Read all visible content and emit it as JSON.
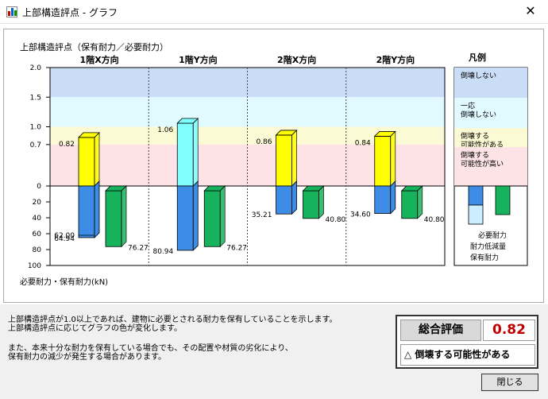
{
  "window": {
    "title": "上部構造評点 - グラフ",
    "close_glyph": "✕"
  },
  "chart_data": {
    "type": "bar",
    "title": "上部構造評点（保有耐力／必要耐力）",
    "bottom_axis_label": "必要耐力・保有耐力(kN)",
    "top_axis": {
      "ylim": [
        0,
        2.0
      ],
      "ticks": [
        "2.0",
        "1.5",
        "1.0",
        "0.7",
        "0"
      ]
    },
    "bottom_axis": {
      "ylim": [
        0,
        100
      ],
      "ticks": [
        "0",
        "20",
        "40",
        "60",
        "80",
        "100"
      ]
    },
    "bands": [
      {
        "from": 1.5,
        "to": 2.0,
        "color": "#c9ddf7"
      },
      {
        "from": 1.0,
        "to": 1.5,
        "color": "#e1faff"
      },
      {
        "from": 0.7,
        "to": 1.0,
        "color": "#fcfad4"
      },
      {
        "from": 0.0,
        "to": 0.7,
        "color": "#fde2e6"
      }
    ],
    "groups": [
      {
        "label": "1階X方向",
        "score": 0.82,
        "score_label": "0.82",
        "score_color": "#ffff00",
        "held_force": 64.94,
        "held_label": "64.94",
        "held_reduced": 62.0,
        "held_reduced_label": "62.00",
        "required_force": 76.27,
        "required_label": "76.27"
      },
      {
        "label": "1階Y方向",
        "score": 1.06,
        "score_label": "1.06",
        "score_color": "#80ffff",
        "held_force": 80.94,
        "held_label": "80.94",
        "required_force": 76.27,
        "required_label": "76.27"
      },
      {
        "label": "2階X方向",
        "score": 0.86,
        "score_label": "0.86",
        "score_color": "#ffff00",
        "held_force": 35.21,
        "held_label": "35.21",
        "required_force": 40.8,
        "required_label": "40.80"
      },
      {
        "label": "2階Y方向",
        "score": 0.84,
        "score_label": "0.84",
        "score_color": "#ffff00",
        "held_force": 34.6,
        "held_label": "34.60",
        "required_force": 40.8,
        "required_label": "40.80"
      }
    ],
    "colors": {
      "held": "#3d8ce6",
      "required": "#17b35c"
    }
  },
  "legend": {
    "title": "凡例",
    "bands": [
      "倒壊しない",
      "一応\n倒壊しない",
      "倒壊する\n可能性がある",
      "倒壊する\n可能性が高い"
    ],
    "bar_labels": [
      "必要耐力",
      "耐力低減量",
      "保有耐力"
    ]
  },
  "notes": [
    "上部構造評点が1.0以上であれば、建物に必要とされる耐力を保有していることを示します。",
    "上部構造評点に応じてグラフの色が変化します。",
    "また、本来十分な耐力を保有している場合でも、その配置や材質の劣化により、",
    "保有耐力の減少が発生する場合があります。"
  ],
  "evaluation": {
    "header": "総合評価",
    "value": "0.82",
    "result_icon": "△",
    "result": "倒壊する可能性がある"
  },
  "close_button": "閉じる"
}
